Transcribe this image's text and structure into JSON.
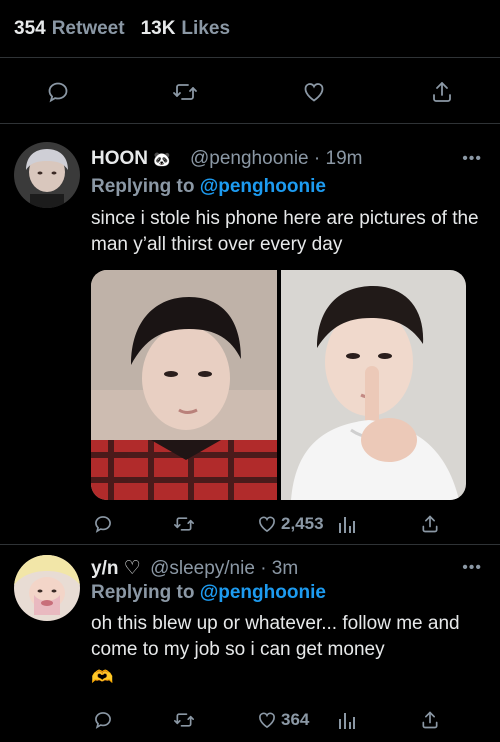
{
  "stats": {
    "retweet_count": "354",
    "retweet_label": "Retweet",
    "likes_count": "13K",
    "likes_label": "Likes"
  },
  "replies": [
    {
      "name": "HOON",
      "emoji": "🐼",
      "handle": "@penghoonie",
      "time": "· 19m",
      "replying_prefix": "Replying to",
      "replying_to": "@penghoonie",
      "text": "since i stole his phone here are pictures of the man y’all thirst over every day",
      "likes": "2,453"
    },
    {
      "name": "y/n",
      "emoji": "♡",
      "handle": "@sleepy/nie",
      "time": "· 3m",
      "replying_prefix": "Replying to",
      "replying_to": "@penghoonie",
      "text": "oh this blew up or whatever... follow me and come to my job so i can get money",
      "trailing_emoji": "🫶",
      "likes": "364"
    }
  ],
  "colors": {
    "background": "#000000",
    "text": "#e7e9ea",
    "muted": "#8b98a5",
    "accent": "#1d9bf0",
    "divider": "#2f3336"
  }
}
